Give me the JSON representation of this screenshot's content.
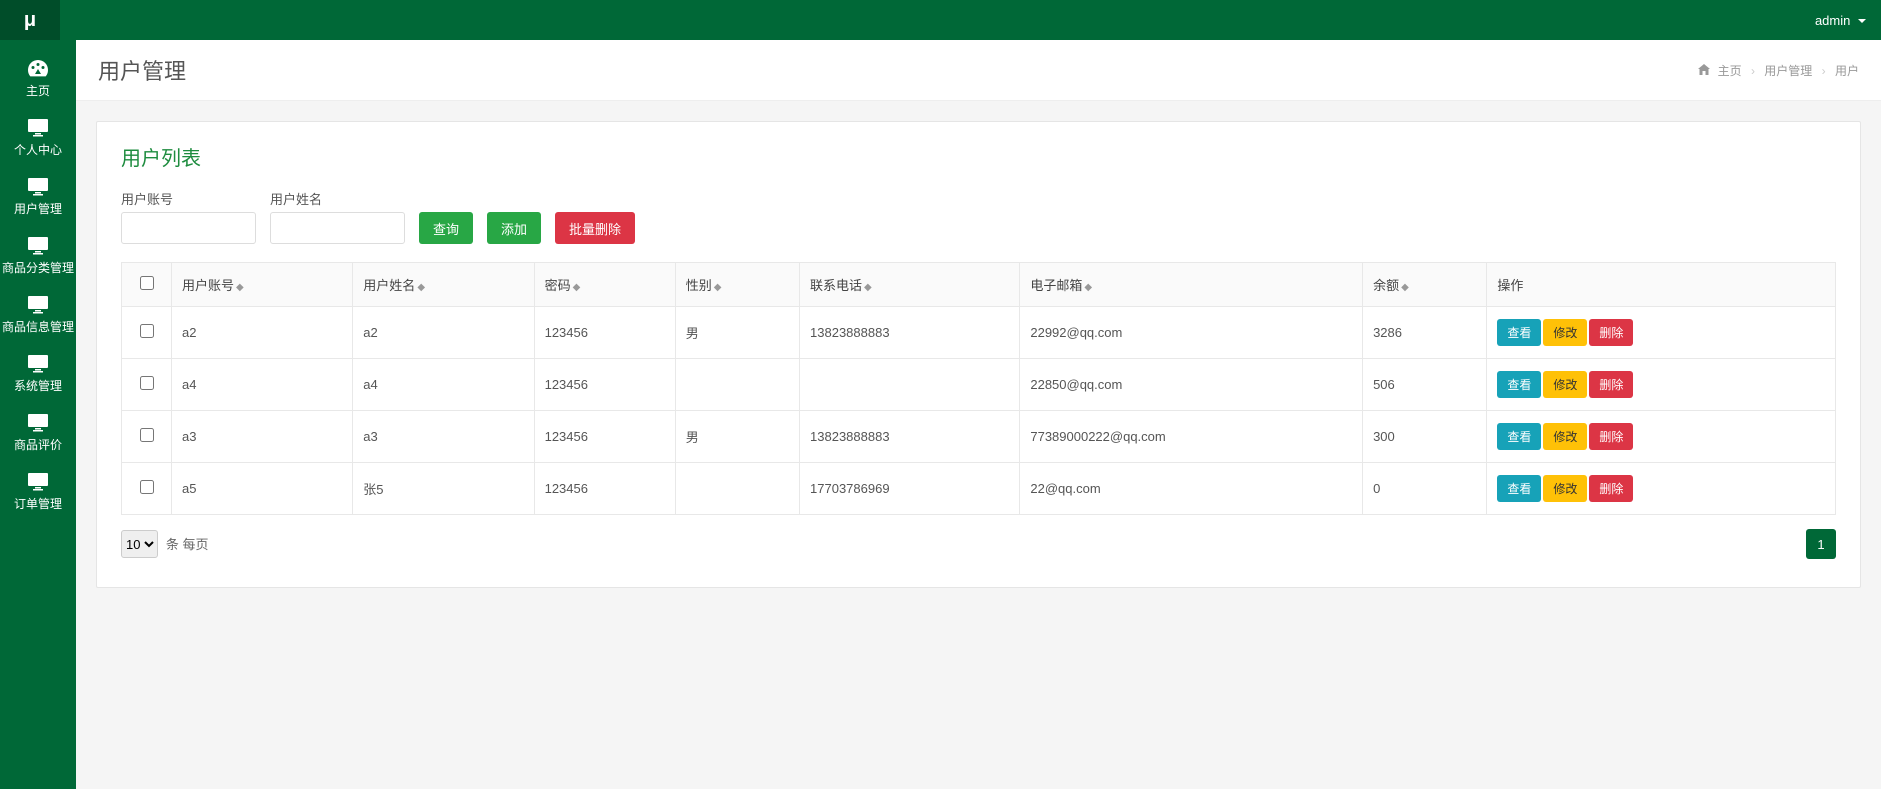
{
  "topbar": {
    "logo": "μ",
    "user": "admin"
  },
  "sidebar": {
    "items": [
      {
        "label": "主页",
        "icon": "dashboard"
      },
      {
        "label": "个人中心",
        "icon": "monitor"
      },
      {
        "label": "用户管理",
        "icon": "monitor"
      },
      {
        "label": "商品分类管理",
        "icon": "monitor"
      },
      {
        "label": "商品信息管理",
        "icon": "monitor"
      },
      {
        "label": "系统管理",
        "icon": "monitor"
      },
      {
        "label": "商品评价",
        "icon": "monitor"
      },
      {
        "label": "订单管理",
        "icon": "monitor"
      }
    ]
  },
  "pagehead": {
    "title": "用户管理",
    "breadcrumb": {
      "home": "主页",
      "section": "用户管理",
      "current": "用户"
    }
  },
  "panel": {
    "title": "用户列表",
    "search": {
      "account_label": "用户账号",
      "name_label": "用户姓名",
      "query_btn": "查询",
      "add_btn": "添加",
      "batch_delete_btn": "批量删除"
    },
    "table": {
      "headers": {
        "account": "用户账号",
        "name": "用户姓名",
        "password": "密码",
        "gender": "性别",
        "phone": "联系电话",
        "email": "电子邮箱",
        "balance": "余额",
        "actions": "操作"
      },
      "rows": [
        {
          "account": "a2",
          "name": "a2",
          "password": "123456",
          "gender": "男",
          "phone": "13823888883",
          "email": "22992@qq.com",
          "balance": "3286"
        },
        {
          "account": "a4",
          "name": "a4",
          "password": "123456",
          "gender": "",
          "phone": "",
          "email": "22850@qq.com",
          "balance": "506"
        },
        {
          "account": "a3",
          "name": "a3",
          "password": "123456",
          "gender": "男",
          "phone": "13823888883",
          "email": "77389000222@qq.com",
          "balance": "300"
        },
        {
          "account": "a5",
          "name": "张5",
          "password": "123456",
          "gender": "",
          "phone": "17703786969",
          "email": "22@qq.com",
          "balance": "0"
        }
      ],
      "actions": {
        "view": "查看",
        "edit": "修改",
        "delete": "删除"
      }
    },
    "footer": {
      "pagesize_value": "10",
      "pagesize_suffix": "条 每页",
      "current_page": "1"
    }
  }
}
